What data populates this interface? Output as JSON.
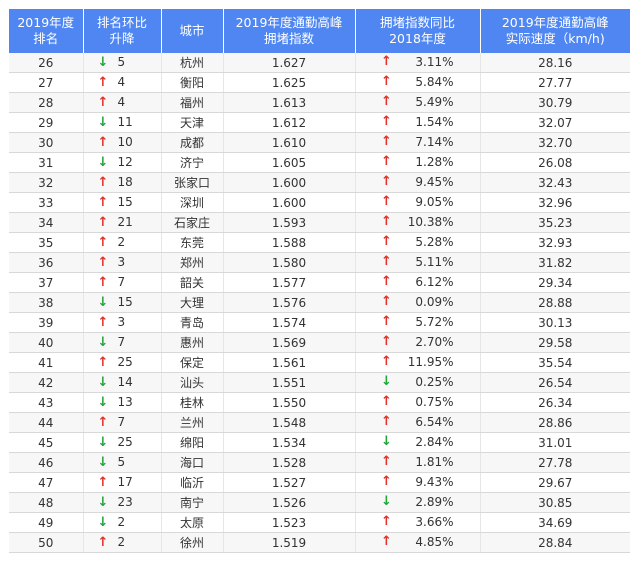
{
  "table": {
    "headers": [
      [
        "2019年度",
        "排名"
      ],
      [
        "排名环比",
        "升降"
      ],
      [
        "城市"
      ],
      [
        "2019年度通勤高峰",
        "拥堵指数"
      ],
      [
        "拥堵指数同比",
        "2018年度"
      ],
      [
        "2019年度通勤高峰",
        "实际速度（km/h)"
      ]
    ],
    "rows": [
      {
        "rank": "26",
        "chg_dir": "down",
        "chg": "5",
        "city": "杭州",
        "index": "1.627",
        "yoy_dir": "up",
        "yoy": "3.11%",
        "speed": "28.16"
      },
      {
        "rank": "27",
        "chg_dir": "up",
        "chg": "4",
        "city": "衡阳",
        "index": "1.625",
        "yoy_dir": "up",
        "yoy": "5.84%",
        "speed": "27.77"
      },
      {
        "rank": "28",
        "chg_dir": "up",
        "chg": "4",
        "city": "福州",
        "index": "1.613",
        "yoy_dir": "up",
        "yoy": "5.49%",
        "speed": "30.79"
      },
      {
        "rank": "29",
        "chg_dir": "down",
        "chg": "11",
        "city": "天津",
        "index": "1.612",
        "yoy_dir": "up",
        "yoy": "1.54%",
        "speed": "32.07"
      },
      {
        "rank": "30",
        "chg_dir": "up",
        "chg": "10",
        "city": "成都",
        "index": "1.610",
        "yoy_dir": "up",
        "yoy": "7.14%",
        "speed": "32.70"
      },
      {
        "rank": "31",
        "chg_dir": "down",
        "chg": "12",
        "city": "济宁",
        "index": "1.605",
        "yoy_dir": "up",
        "yoy": "1.28%",
        "speed": "26.08"
      },
      {
        "rank": "32",
        "chg_dir": "up",
        "chg": "18",
        "city": "张家口",
        "index": "1.600",
        "yoy_dir": "up",
        "yoy": "9.45%",
        "speed": "32.43"
      },
      {
        "rank": "33",
        "chg_dir": "up",
        "chg": "15",
        "city": "深圳",
        "index": "1.600",
        "yoy_dir": "up",
        "yoy": "9.05%",
        "speed": "32.96"
      },
      {
        "rank": "34",
        "chg_dir": "up",
        "chg": "21",
        "city": "石家庄",
        "index": "1.593",
        "yoy_dir": "up",
        "yoy": "10.38%",
        "speed": "35.23"
      },
      {
        "rank": "35",
        "chg_dir": "up",
        "chg": "2",
        "city": "东莞",
        "index": "1.588",
        "yoy_dir": "up",
        "yoy": "5.28%",
        "speed": "32.93"
      },
      {
        "rank": "36",
        "chg_dir": "up",
        "chg": "3",
        "city": "郑州",
        "index": "1.580",
        "yoy_dir": "up",
        "yoy": "5.11%",
        "speed": "31.82"
      },
      {
        "rank": "37",
        "chg_dir": "up",
        "chg": "7",
        "city": "韶关",
        "index": "1.577",
        "yoy_dir": "up",
        "yoy": "6.12%",
        "speed": "29.34"
      },
      {
        "rank": "38",
        "chg_dir": "down",
        "chg": "15",
        "city": "大理",
        "index": "1.576",
        "yoy_dir": "up",
        "yoy": "0.09%",
        "speed": "28.88"
      },
      {
        "rank": "39",
        "chg_dir": "up",
        "chg": "3",
        "city": "青岛",
        "index": "1.574",
        "yoy_dir": "up",
        "yoy": "5.72%",
        "speed": "30.13"
      },
      {
        "rank": "40",
        "chg_dir": "down",
        "chg": "7",
        "city": "惠州",
        "index": "1.569",
        "yoy_dir": "up",
        "yoy": "2.70%",
        "speed": "29.58"
      },
      {
        "rank": "41",
        "chg_dir": "up",
        "chg": "25",
        "city": "保定",
        "index": "1.561",
        "yoy_dir": "up",
        "yoy": "11.95%",
        "speed": "35.54"
      },
      {
        "rank": "42",
        "chg_dir": "down",
        "chg": "14",
        "city": "汕头",
        "index": "1.551",
        "yoy_dir": "down",
        "yoy": "0.25%",
        "speed": "26.54"
      },
      {
        "rank": "43",
        "chg_dir": "down",
        "chg": "13",
        "city": "桂林",
        "index": "1.550",
        "yoy_dir": "up",
        "yoy": "0.75%",
        "speed": "26.34"
      },
      {
        "rank": "44",
        "chg_dir": "up",
        "chg": "7",
        "city": "兰州",
        "index": "1.548",
        "yoy_dir": "up",
        "yoy": "6.54%",
        "speed": "28.86"
      },
      {
        "rank": "45",
        "chg_dir": "down",
        "chg": "25",
        "city": "绵阳",
        "index": "1.534",
        "yoy_dir": "down",
        "yoy": "2.84%",
        "speed": "31.01"
      },
      {
        "rank": "46",
        "chg_dir": "down",
        "chg": "5",
        "city": "海口",
        "index": "1.528",
        "yoy_dir": "up",
        "yoy": "1.81%",
        "speed": "27.78"
      },
      {
        "rank": "47",
        "chg_dir": "up",
        "chg": "17",
        "city": "临沂",
        "index": "1.527",
        "yoy_dir": "up",
        "yoy": "9.43%",
        "speed": "29.67"
      },
      {
        "rank": "48",
        "chg_dir": "down",
        "chg": "23",
        "city": "南宁",
        "index": "1.526",
        "yoy_dir": "down",
        "yoy": "2.89%",
        "speed": "30.85"
      },
      {
        "rank": "49",
        "chg_dir": "down",
        "chg": "2",
        "city": "太原",
        "index": "1.523",
        "yoy_dir": "up",
        "yoy": "3.66%",
        "speed": "34.69"
      },
      {
        "rank": "50",
        "chg_dir": "up",
        "chg": "2",
        "city": "徐州",
        "index": "1.519",
        "yoy_dir": "up",
        "yoy": "4.85%",
        "speed": "28.84"
      }
    ]
  },
  "arrows": {
    "up": "↑",
    "down": "↓"
  },
  "colors": {
    "header_bg": "#4f86f2",
    "up": "#e0322a",
    "down": "#20a53a"
  }
}
